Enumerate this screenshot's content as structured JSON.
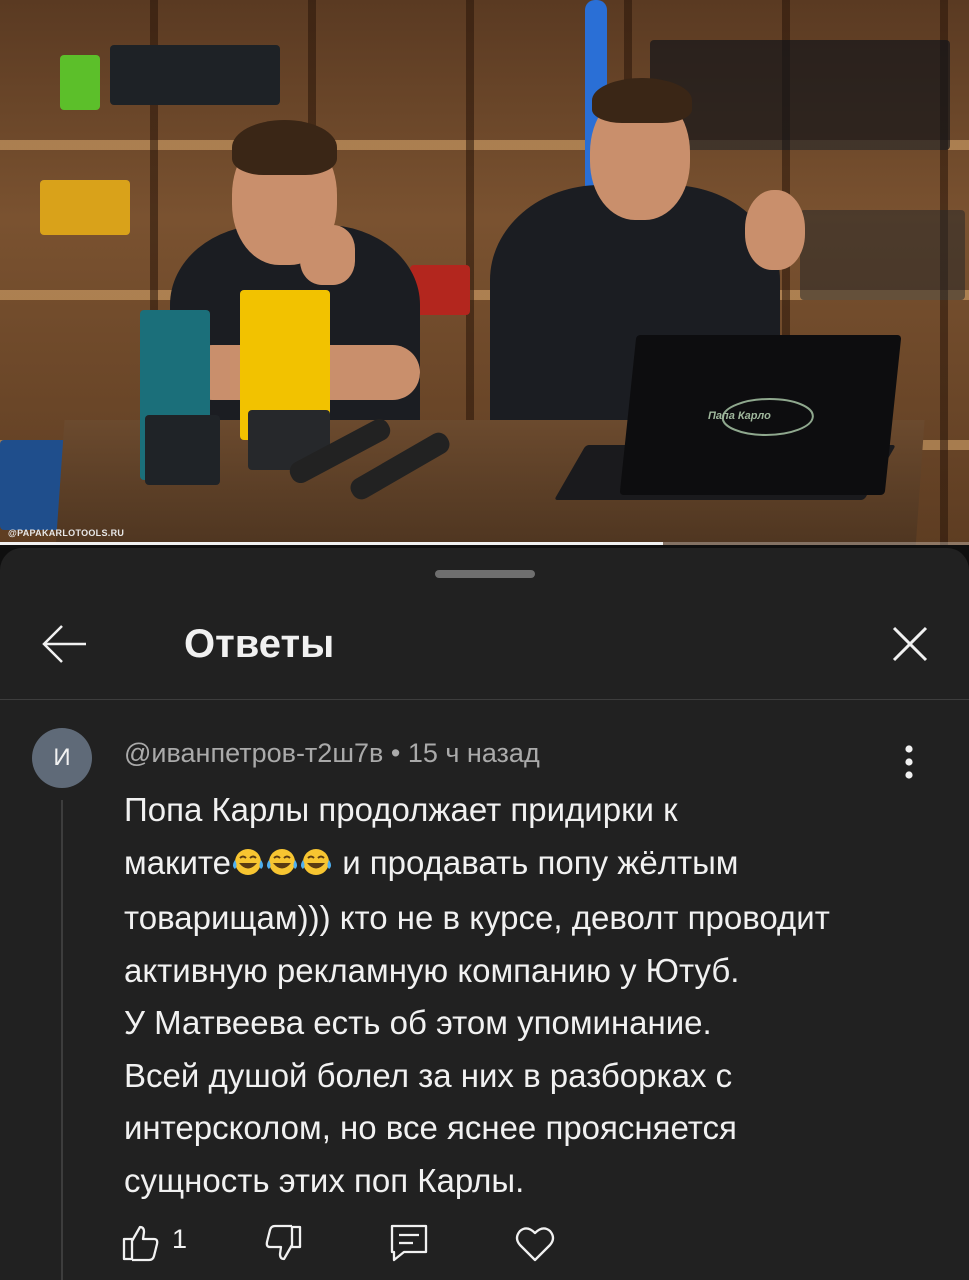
{
  "video": {
    "watermark": "@PAPAKARLOTOOLS.RU",
    "laptop_logo": "Папа Карло",
    "progress": 0.684
  },
  "panel": {
    "title": "Ответы",
    "back_icon": "arrow-left-icon",
    "close_icon": "close-icon"
  },
  "comment": {
    "avatar_letter": "И",
    "author": "@иванпетров-т2ш7в",
    "separator": "•",
    "time": "15 ч назад",
    "lines": [
      "Попа Карлы продолжает придирки к",
      "и продавать попу жёлтым",
      "товарищам))) кто не в курсе, деволт проводит",
      "активную рекламную компанию у Ютуб.",
      "У Матвеева есть об этом упоминание.",
      "Всей душой болел за них в разборках с",
      "интерсколом, но все яснее проясняется",
      "сущность этих поп Карлы."
    ],
    "line2_prefix": "маките",
    "emojis": [
      "face-with-tears-of-joy",
      "face-with-tears-of-joy",
      "face-with-tears-of-joy"
    ],
    "like_count": "1"
  },
  "colors": {
    "panel_bg": "#212121",
    "page_bg": "#0f0f0f",
    "text_primary": "#f1f1f1",
    "text_secondary": "#aaaaaa",
    "avatar_bg": "#5f6a78"
  }
}
